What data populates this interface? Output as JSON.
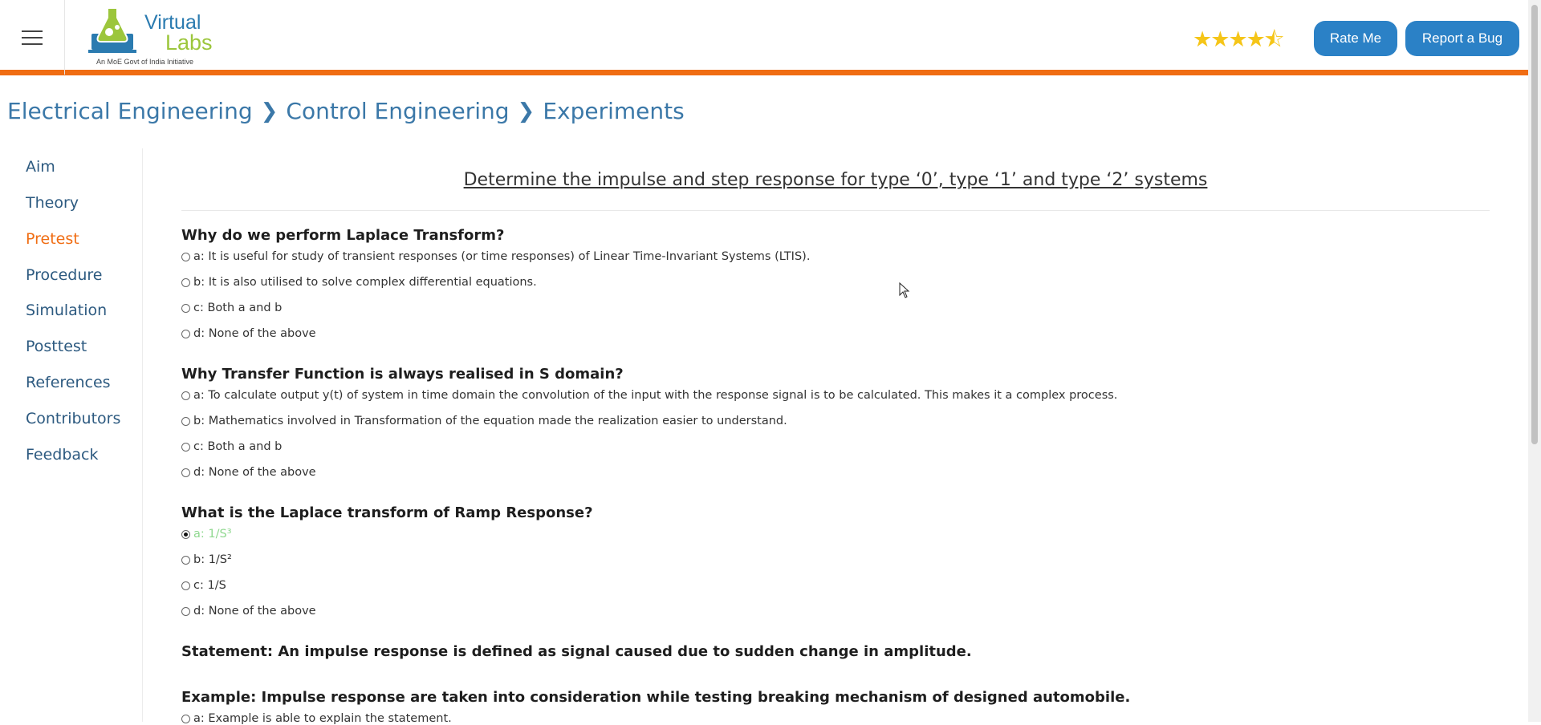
{
  "header": {
    "logo": {
      "line1": "Virtual",
      "line2": "Labs",
      "tagline": "An MoE Govt of India Initiative"
    },
    "rating_value": 4.5,
    "rate_button": "Rate Me",
    "bug_button": "Report a Bug"
  },
  "breadcrumb": [
    "Electrical Engineering",
    "Control Engineering",
    "Experiments"
  ],
  "sidebar": {
    "items": [
      {
        "label": "Aim"
      },
      {
        "label": "Theory"
      },
      {
        "label": "Pretest",
        "active": true
      },
      {
        "label": "Procedure"
      },
      {
        "label": "Simulation"
      },
      {
        "label": "Posttest"
      },
      {
        "label": "References"
      },
      {
        "label": "Contributors"
      },
      {
        "label": "Feedback"
      }
    ]
  },
  "page_title": "Determine the impulse and step response for type ‘0’, type ‘1’ and type ‘2’ systems",
  "questions": [
    {
      "text": "Why do we perform Laplace Transform?",
      "options": [
        "a: It is useful for study of transient responses (or time responses) of Linear Time-Invariant Systems (LTIS).",
        "b: It is also utilised to solve complex differential equations.",
        "c: Both a and b",
        "d: None of the above"
      ]
    },
    {
      "text": "Why Transfer Function is always realised in S domain?",
      "options": [
        "a: To calculate output y(t) of system in time domain the convolution of the input with the response signal is to be calculated. This makes it a complex process.",
        "b: Mathematics involved in Transformation of the equation made the realization easier to understand.",
        "c: Both a and b",
        "d: None of the above"
      ]
    },
    {
      "text": "What is the Laplace transform of Ramp Response?",
      "selected": 0,
      "options": [
        "a: 1/S³",
        "b: 1/S²",
        "c: 1/S",
        "d: None of the above"
      ]
    }
  ],
  "statement": "Statement: An impulse response is defined as signal caused due to sudden change in amplitude.",
  "example": "Example: Impulse response are taken into consideration while testing breaking mechanism of designed automobile.",
  "example_option_a": "a: Example is able to explain the statement."
}
